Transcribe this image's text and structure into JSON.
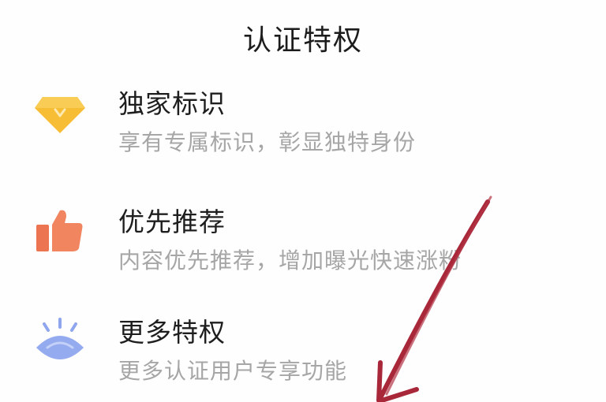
{
  "header": {
    "title": "认证特权"
  },
  "privileges": [
    {
      "name": "独家标识",
      "description": "享有专属标识，彰显独特身份",
      "icon": "diamond-icon",
      "color": "#f5b830"
    },
    {
      "name": "优先推荐",
      "description": "内容优先推荐，增加曝光快速涨粉",
      "icon": "thumbs-up-icon",
      "color": "#ee7a55"
    },
    {
      "name": "更多特权",
      "description": "更多认证用户专享功能",
      "icon": "eye-icon",
      "color": "#8fa6ee"
    }
  ],
  "annotation": {
    "arrow_color": "#a8283a"
  }
}
